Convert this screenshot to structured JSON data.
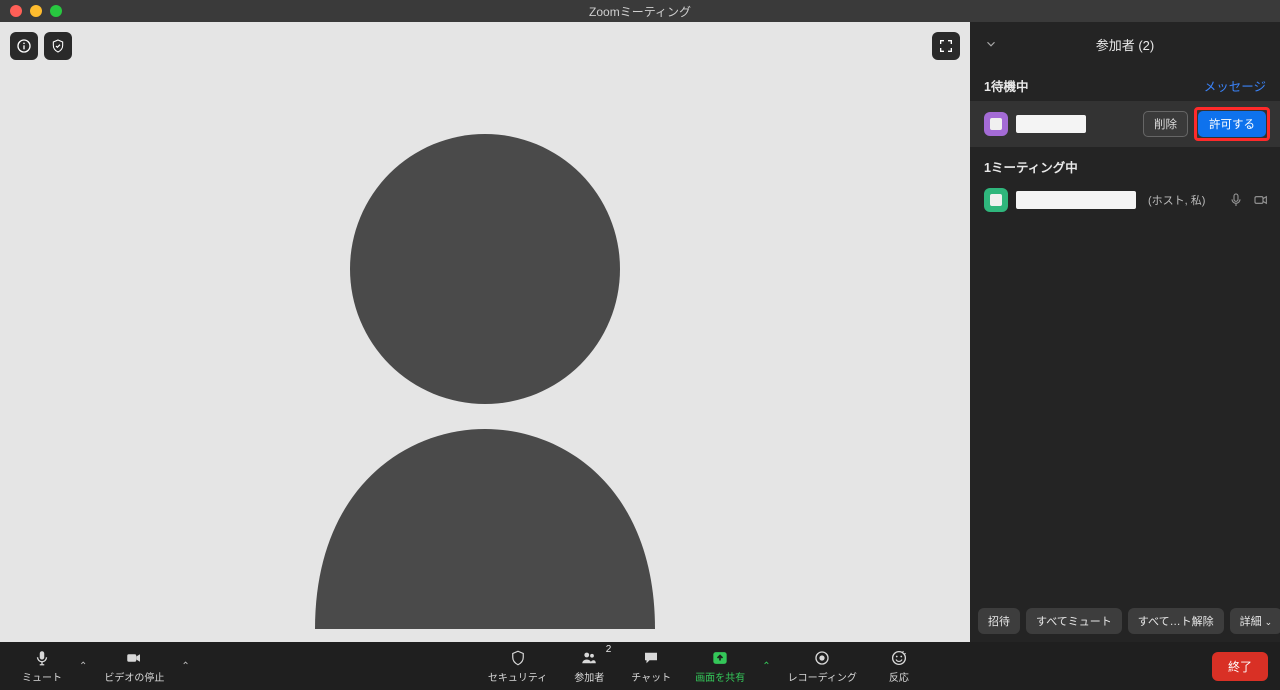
{
  "window": {
    "title": "Zoomミーティング"
  },
  "panel": {
    "title": "参加者 (2)",
    "waiting_header": "1待機中",
    "message_link": "メッセージ",
    "remove_label": "削除",
    "admit_label": "許可する",
    "in_meeting_header": "1ミーティング中",
    "host_meta": "(ホスト, 私)",
    "waiting_avatar_color": "#a46bd6",
    "meeting_avatar_color": "#2fb67c"
  },
  "toolbar": {
    "mute": "ミュート",
    "stop_video": "ビデオの停止",
    "security": "セキュリティ",
    "participants": "参加者",
    "participants_count": "2",
    "chat": "チャット",
    "share_screen": "画面を共有",
    "recording": "レコーディング",
    "reactions": "反応",
    "end": "終了"
  },
  "panel_footer": {
    "invite": "招待",
    "mute_all": "すべてミュート",
    "unmute_all": "すべて…ト解除",
    "more": "詳細"
  }
}
